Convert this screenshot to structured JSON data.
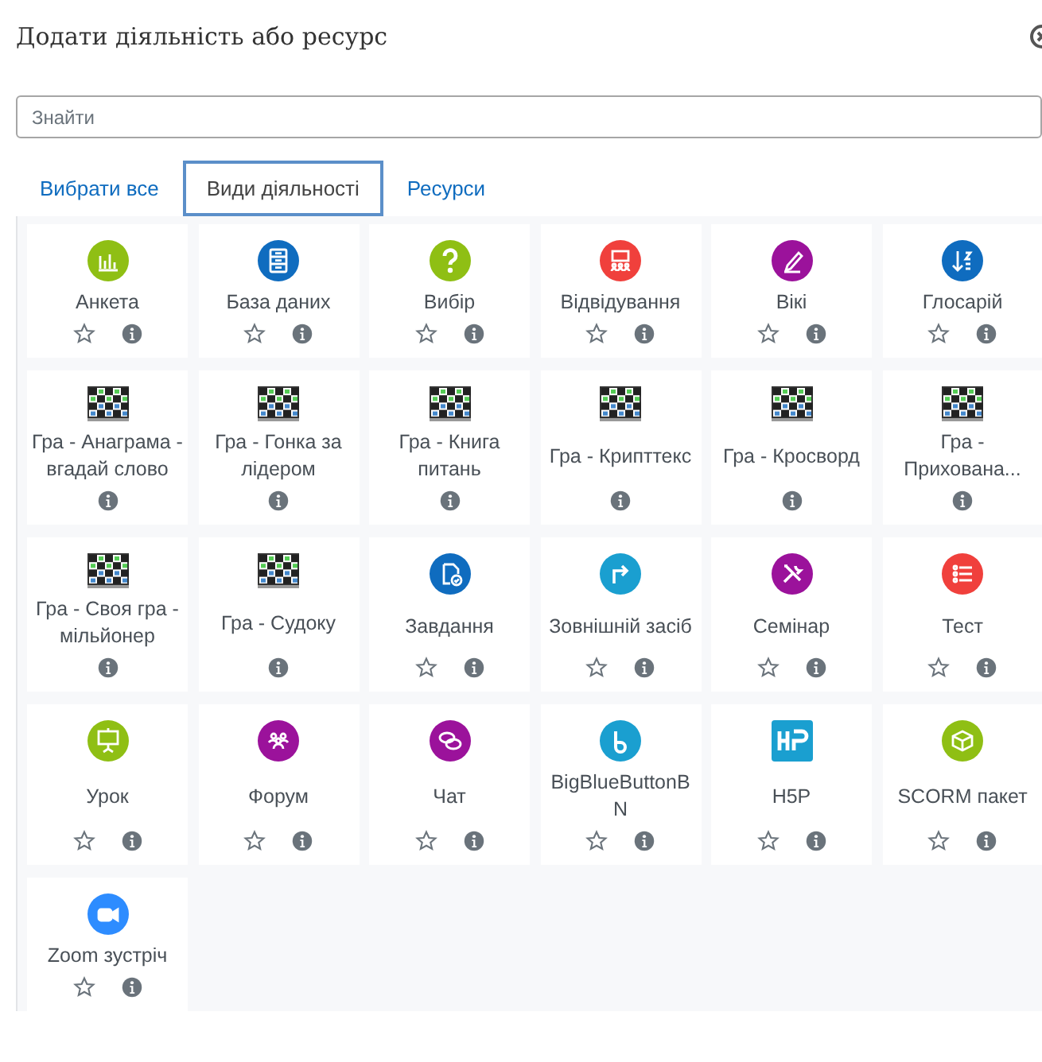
{
  "dialog": {
    "title": "Додати діяльність або ресурс"
  },
  "search": {
    "placeholder": "Знайти"
  },
  "tabs": [
    {
      "label": "Вибрати все",
      "selected": false
    },
    {
      "label": "Види діяльності",
      "selected": true
    },
    {
      "label": "Ресурси",
      "selected": false
    }
  ],
  "items": [
    {
      "label": "Анкета",
      "kind": "survey"
    },
    {
      "label": "База даних",
      "kind": "database"
    },
    {
      "label": "Вибір",
      "kind": "choice"
    },
    {
      "label": "Відвідування",
      "kind": "attendance"
    },
    {
      "label": "Вікі",
      "kind": "wiki"
    },
    {
      "label": "Глосарій",
      "kind": "glossary"
    },
    {
      "label": "Гра - Анаграма - вгадай слово",
      "kind": "game"
    },
    {
      "label": "Гра - Гонка за лідером",
      "kind": "game"
    },
    {
      "label": "Гра - Книга питань",
      "kind": "game"
    },
    {
      "label": "Гра - Крипттекс",
      "kind": "game"
    },
    {
      "label": "Гра - Кросворд",
      "kind": "game"
    },
    {
      "label": "Гра - Прихована...",
      "kind": "game"
    },
    {
      "label": "Гра - Своя гра - мільйонер",
      "kind": "game"
    },
    {
      "label": "Гра - Судоку",
      "kind": "game"
    },
    {
      "label": "Завдання",
      "kind": "assignment"
    },
    {
      "label": "Зовнішній засіб",
      "kind": "external"
    },
    {
      "label": "Семінар",
      "kind": "workshop"
    },
    {
      "label": "Тест",
      "kind": "quiz"
    },
    {
      "label": "Урок",
      "kind": "lesson"
    },
    {
      "label": "Форум",
      "kind": "forum"
    },
    {
      "label": "Чат",
      "kind": "chat"
    },
    {
      "label": "BigBlueButtonBN",
      "kind": "conference"
    },
    {
      "label": "H5P",
      "kind": "h5p"
    },
    {
      "label": "SCORM пакет",
      "kind": "package"
    },
    {
      "label": "Zoom зустріч",
      "kind": "video"
    }
  ]
}
